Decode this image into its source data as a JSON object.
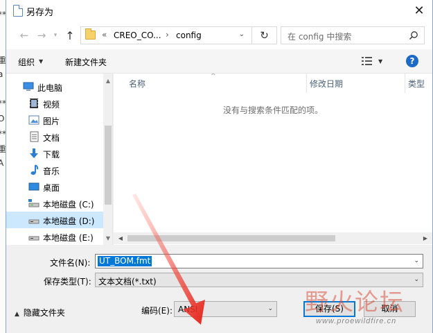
{
  "background_edge": {
    "fragments": [
      "**",
      "重",
      "a",
      "**",
      "O",
      "**",
      "重",
      "A"
    ]
  },
  "window": {
    "title": "另存为",
    "close_glyph": "✕"
  },
  "nav": {
    "address_segments": [
      "«",
      "CREO_CO...",
      "›",
      "config"
    ],
    "search_placeholder": "在 config 中搜索"
  },
  "toolbar": {
    "organize_label": "组织",
    "new_folder_label": "新建文件夹",
    "help_label": "?"
  },
  "sidebar": {
    "items": [
      {
        "label": "此电脑",
        "icon": "computer-icon"
      },
      {
        "label": "视频",
        "icon": "video-icon"
      },
      {
        "label": "图片",
        "icon": "pictures-icon"
      },
      {
        "label": "文档",
        "icon": "documents-icon"
      },
      {
        "label": "下载",
        "icon": "download-icon"
      },
      {
        "label": "音乐",
        "icon": "music-icon"
      },
      {
        "label": "桌面",
        "icon": "desktop-icon"
      },
      {
        "label": "本地磁盘 (C:)",
        "icon": "drive-icon"
      },
      {
        "label": "本地磁盘 (D:)",
        "icon": "drive-icon",
        "selected": true
      },
      {
        "label": "本地磁盘 (E:)",
        "icon": "drive-icon"
      }
    ]
  },
  "filelist": {
    "columns": [
      "名称",
      "修改日期",
      "类型"
    ],
    "empty_message": "没有与搜索条件匹配的项。"
  },
  "form": {
    "filename_label": "文件名(N):",
    "filename_value": "UT_BOM.fmt",
    "filetype_label": "保存类型(T):",
    "filetype_value": "文本文档(*.txt)",
    "encoding_label": "编码(E):",
    "encoding_value": "ANSI",
    "hide_folders_label": "隐藏文件夹",
    "save_label": "保存(S)",
    "cancel_label": "取消"
  },
  "watermark": {
    "text": "野火论坛",
    "url": "www.proewildfire.cn"
  },
  "colors": {
    "selection": "#0078d7",
    "nav_selected": "#cce8ff",
    "annotation_arrow": "#e5251b",
    "help_icon": "#1c6ac7"
  }
}
